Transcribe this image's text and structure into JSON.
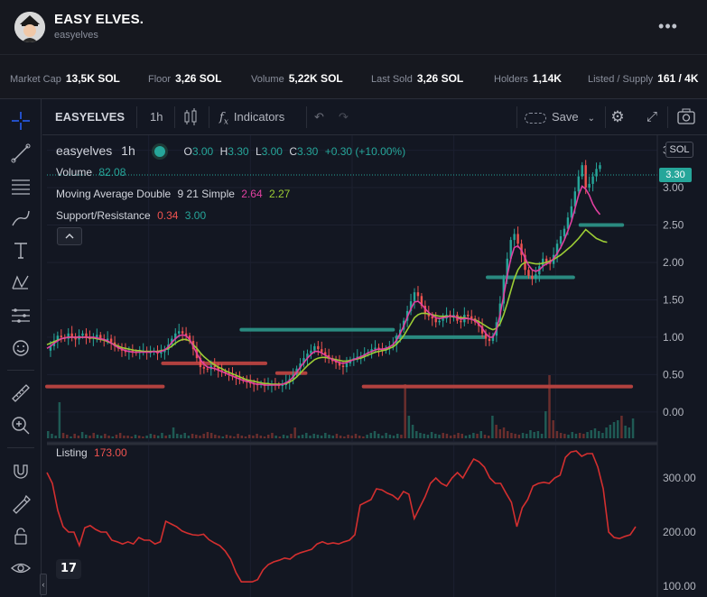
{
  "header": {
    "title": "EASY ELVES.",
    "subtitle": "easyelves",
    "more_label": "•••"
  },
  "stats": [
    {
      "label": "Market Cap",
      "value": "13,5K SOL"
    },
    {
      "label": "Floor",
      "value": "3,26 SOL"
    },
    {
      "label": "Volume",
      "value": "5,22K SOL"
    },
    {
      "label": "Last Sold",
      "value": "3,26 SOL"
    },
    {
      "label": "Holders",
      "value": "1,14K"
    },
    {
      "label": "Listed / Supply",
      "value": "161 / 4K"
    }
  ],
  "toolbar": {
    "symbol": "EASYELVES",
    "interval": "1h",
    "indicators_label": "Indicators",
    "save_label": "Save"
  },
  "legend": {
    "symbol": "easyelves",
    "interval": "1h",
    "o_label": "O",
    "o": "3.00",
    "h_label": "H",
    "h": "3.30",
    "l_label": "L",
    "l": "3.00",
    "c_label": "C",
    "c": "3.30",
    "change": "+0.30 (+10.00%)",
    "volume_label": "Volume",
    "volume": "82.08",
    "ma_label": "Moving Average Double",
    "ma_params": "9 21 Simple",
    "ma1": "2.64",
    "ma2": "2.27",
    "sr_label": "Support/Resistance",
    "sr1": "0.34",
    "sr2": "3.00",
    "listing_label": "Listing",
    "listing": "173.00"
  },
  "price_axis": {
    "currency": "SOL",
    "last_price": "3.30",
    "ticks": [
      "3.50",
      "3.00",
      "2.50",
      "2.00",
      "1.50",
      "1.00",
      "0.50",
      "0.00"
    ]
  },
  "listing_axis": {
    "ticks": [
      "300.00",
      "200.00",
      "100.00"
    ]
  },
  "colors": {
    "up": "#26a69a",
    "down": "#ef5350",
    "ma_fast": "#e040a0",
    "ma_slow": "#9ccc35",
    "support": "#b2413f",
    "resistance": "#2a8a80",
    "listing": "#d32f2f"
  },
  "chart_data": {
    "type": "line",
    "price_series": {
      "name": "easyelves",
      "x": [
        0,
        4,
        8,
        12,
        16,
        20,
        24,
        28,
        32,
        36,
        40,
        44,
        48,
        52,
        56,
        60,
        64,
        68,
        72,
        76,
        80,
        84,
        88,
        92,
        96,
        100,
        104,
        108,
        112,
        116,
        120,
        124,
        128,
        132,
        136,
        140,
        144,
        148,
        152,
        156,
        160,
        164,
        168,
        172,
        176,
        180,
        184,
        188,
        192,
        196,
        200,
        204,
        208,
        212,
        216,
        220,
        224,
        228,
        232,
        236,
        240,
        244,
        248,
        252,
        256,
        260,
        264,
        268,
        272,
        276,
        280,
        284,
        288,
        292,
        296,
        300,
        304,
        308,
        312,
        316,
        320,
        324,
        328,
        332,
        336,
        340,
        344,
        348,
        352,
        356,
        360,
        364,
        368,
        372,
        376,
        380,
        384,
        388,
        392,
        396,
        400,
        404,
        408,
        412,
        416,
        420,
        424,
        428,
        432,
        436,
        440,
        444,
        448,
        452,
        456,
        460,
        464,
        468,
        472,
        476,
        480,
        484,
        488,
        492,
        496,
        500,
        504,
        508,
        512,
        516,
        520,
        524,
        528,
        532,
        536,
        540,
        544,
        548,
        552,
        556,
        560,
        564,
        568,
        572,
        576,
        580,
        584,
        588,
        592,
        596,
        600,
        604,
        608,
        612,
        616,
        620,
        624,
        628,
        632,
        636,
        640,
        644,
        648,
        652,
        656,
        660
      ],
      "y": [
        0.82,
        0.88,
        0.95,
        1.02,
        1.0,
        0.98,
        1.05,
        1.0,
        0.97,
        1.02,
        1.05,
        0.99,
        0.98,
        1.0,
        1.03,
        0.97,
        0.96,
        0.98,
        0.93,
        0.88,
        0.85,
        0.82,
        0.8,
        0.82,
        0.8,
        0.79,
        0.81,
        0.82,
        0.8,
        0.8,
        0.82,
        0.78,
        0.8,
        0.83,
        0.9,
        0.98,
        1.05,
        1.08,
        1.05,
        1.02,
        0.95,
        0.84,
        0.72,
        0.6,
        0.58,
        0.57,
        0.62,
        0.6,
        0.56,
        0.54,
        0.52,
        0.5,
        0.48,
        0.46,
        0.44,
        0.42,
        0.4,
        0.38,
        0.37,
        0.36,
        0.38,
        0.35,
        0.36,
        0.37,
        0.36,
        0.35,
        0.36,
        0.4,
        0.44,
        0.5,
        0.58,
        0.65,
        0.72,
        0.78,
        0.82,
        0.88,
        0.84,
        0.8,
        0.76,
        0.72,
        0.68,
        0.66,
        0.62,
        0.6,
        0.65,
        0.7,
        0.72,
        0.74,
        0.75,
        0.78,
        0.8,
        0.84,
        0.86,
        0.84,
        0.82,
        0.85,
        0.88,
        0.9,
        1.0,
        1.1,
        1.22,
        1.35,
        1.48,
        1.6,
        1.55,
        1.42,
        1.32,
        1.28,
        1.25,
        1.2,
        1.22,
        1.25,
        1.3,
        1.28,
        1.3,
        1.22,
        1.2,
        1.3,
        1.28,
        1.25,
        1.2,
        1.15,
        1.05,
        0.98,
        0.95,
        1.02,
        1.2,
        1.45,
        1.78,
        2.05,
        2.3,
        2.38,
        2.25,
        2.1,
        1.9,
        1.82,
        1.78,
        1.84,
        1.95,
        2.05,
        2.0,
        1.98,
        2.1,
        2.25,
        2.35,
        2.45,
        2.6,
        2.75,
        2.95,
        3.15,
        3.3,
        3.0,
        3.05,
        3.15,
        3.25,
        3.3
      ],
      "ma_fast": [
        0.85,
        0.88,
        0.92,
        0.95,
        0.98,
        0.99,
        1.0,
        1.0,
        1.0,
        1.0,
        1.0,
        1.0,
        1.0,
        1.0,
        0.99,
        0.98,
        0.97,
        0.95,
        0.92,
        0.89,
        0.86,
        0.84,
        0.82,
        0.81,
        0.8,
        0.8,
        0.8,
        0.8,
        0.8,
        0.8,
        0.81,
        0.8,
        0.81,
        0.83,
        0.87,
        0.93,
        0.98,
        1.02,
        1.03,
        1.02,
        0.97,
        0.88,
        0.78,
        0.7,
        0.64,
        0.6,
        0.59,
        0.58,
        0.56,
        0.54,
        0.52,
        0.5,
        0.48,
        0.46,
        0.44,
        0.42,
        0.41,
        0.4,
        0.38,
        0.37,
        0.37,
        0.36,
        0.36,
        0.36,
        0.36,
        0.36,
        0.37,
        0.39,
        0.42,
        0.47,
        0.53,
        0.6,
        0.66,
        0.72,
        0.77,
        0.81,
        0.81,
        0.79,
        0.76,
        0.73,
        0.7,
        0.68,
        0.66,
        0.65,
        0.66,
        0.68,
        0.7,
        0.72,
        0.74,
        0.76,
        0.79,
        0.81,
        0.83,
        0.84,
        0.84,
        0.85,
        0.87,
        0.9,
        0.96,
        1.05,
        1.15,
        1.27,
        1.38,
        1.47,
        1.48,
        1.44,
        1.38,
        1.33,
        1.29,
        1.26,
        1.25,
        1.26,
        1.27,
        1.28,
        1.28,
        1.26,
        1.24,
        1.25,
        1.25,
        1.24,
        1.22,
        1.18,
        1.12,
        1.05,
        1.0,
        1.0,
        1.1,
        1.3,
        1.55,
        1.82,
        2.05,
        2.2,
        2.22,
        2.16,
        2.06,
        1.96,
        1.9,
        1.88,
        1.9,
        1.95,
        1.98,
        2.0,
        2.05,
        2.12,
        2.2,
        2.3,
        2.42,
        2.55,
        2.72,
        2.9,
        3.02,
        2.98,
        2.9,
        2.78,
        2.7,
        2.64
      ],
      "ma_slow": [
        0.9,
        0.92,
        0.94,
        0.96,
        0.98,
        0.99,
        1.0,
        1.0,
        1.0,
        1.0,
        1.0,
        1.0,
        0.99,
        0.99,
        0.98,
        0.97,
        0.96,
        0.94,
        0.92,
        0.9,
        0.88,
        0.86,
        0.85,
        0.84,
        0.83,
        0.82,
        0.82,
        0.81,
        0.81,
        0.81,
        0.81,
        0.81,
        0.82,
        0.83,
        0.85,
        0.88,
        0.92,
        0.95,
        0.97,
        0.97,
        0.95,
        0.9,
        0.85,
        0.79,
        0.74,
        0.7,
        0.66,
        0.63,
        0.6,
        0.58,
        0.55,
        0.53,
        0.51,
        0.49,
        0.47,
        0.45,
        0.43,
        0.42,
        0.41,
        0.4,
        0.39,
        0.38,
        0.38,
        0.37,
        0.37,
        0.37,
        0.37,
        0.38,
        0.4,
        0.43,
        0.47,
        0.52,
        0.57,
        0.62,
        0.66,
        0.7,
        0.72,
        0.73,
        0.73,
        0.72,
        0.71,
        0.7,
        0.69,
        0.68,
        0.68,
        0.69,
        0.7,
        0.71,
        0.72,
        0.74,
        0.76,
        0.78,
        0.8,
        0.81,
        0.82,
        0.83,
        0.85,
        0.87,
        0.91,
        0.96,
        1.02,
        1.1,
        1.18,
        1.26,
        1.3,
        1.32,
        1.32,
        1.31,
        1.3,
        1.29,
        1.28,
        1.28,
        1.28,
        1.28,
        1.27,
        1.27,
        1.26,
        1.26,
        1.25,
        1.24,
        1.23,
        1.21,
        1.18,
        1.15,
        1.12,
        1.1,
        1.12,
        1.18,
        1.3,
        1.45,
        1.62,
        1.78,
        1.9,
        1.97,
        2.0,
        2.0,
        1.99,
        1.98,
        1.98,
        1.99,
        2.0,
        2.02,
        2.04,
        2.07,
        2.1,
        2.14,
        2.18,
        2.22,
        2.27,
        2.32,
        2.38,
        2.44,
        2.4,
        2.36,
        2.32,
        2.3,
        2.28,
        2.27
      ]
    },
    "support_resistance": [
      {
        "y": 0.34,
        "x0": 0,
        "x1": 130
      },
      {
        "y": 0.34,
        "x0": 355,
        "x1": 655
      },
      {
        "y": 0.65,
        "x0": 130,
        "x1": 245
      },
      {
        "y": 0.52,
        "x0": 258,
        "x1": 290
      },
      {
        "y": 1.1,
        "x0": 218,
        "x1": 388
      },
      {
        "y": 1.0,
        "x0": 392,
        "x1": 490
      },
      {
        "y": 1.8,
        "x0": 494,
        "x1": 590
      },
      {
        "y": 2.5,
        "x0": 598,
        "x1": 645
      }
    ],
    "volume": [
      8,
      5,
      3,
      40,
      6,
      4,
      2,
      5,
      3,
      7,
      4,
      3,
      6,
      4,
      3,
      5,
      3,
      2,
      4,
      6,
      3,
      3,
      2,
      4,
      3,
      2,
      3,
      5,
      4,
      3,
      6,
      3,
      4,
      12,
      5,
      4,
      6,
      3,
      5,
      4,
      3,
      5,
      7,
      6,
      4,
      3,
      2,
      4,
      3,
      2,
      5,
      3,
      2,
      4,
      3,
      5,
      3,
      2,
      4,
      6,
      3,
      2,
      4,
      3,
      5,
      12,
      3,
      4,
      6,
      3,
      5,
      4,
      3,
      6,
      4,
      3,
      5,
      3,
      2,
      4,
      3,
      5,
      3,
      2,
      4,
      6,
      8,
      5,
      3,
      6,
      4,
      3,
      5,
      4,
      60,
      25,
      15,
      8,
      6,
      5,
      4,
      7,
      5,
      4,
      6,
      5,
      3,
      4,
      6,
      5,
      3,
      4,
      6,
      5,
      8,
      4,
      3,
      25,
      15,
      10,
      12,
      8,
      6,
      5,
      4,
      6,
      5,
      9,
      7,
      8,
      5,
      30,
      70,
      20,
      8,
      6,
      5,
      4,
      7,
      5,
      6,
      5,
      7,
      9,
      11,
      8,
      6,
      12,
      15,
      18,
      20,
      25,
      14,
      12,
      22
    ],
    "listing": {
      "name": "Listing",
      "x": [
        0,
        6,
        12,
        18,
        24,
        30,
        36,
        42,
        48,
        54,
        60,
        66,
        72,
        78,
        84,
        90,
        96,
        102,
        108,
        114,
        120,
        126,
        132,
        138,
        144,
        150,
        156,
        162,
        168,
        174,
        180,
        186,
        192,
        198,
        204,
        210,
        216,
        222,
        228,
        234,
        240,
        246,
        252,
        258,
        264,
        270,
        276,
        282,
        288,
        294,
        300,
        306,
        312,
        318,
        324,
        330,
        336,
        342,
        348,
        354,
        360,
        366,
        372,
        378,
        384,
        390,
        396,
        402,
        408,
        414,
        420,
        426,
        432,
        438,
        444,
        450,
        456,
        462,
        468,
        474,
        480,
        486,
        492,
        498,
        504,
        510,
        516,
        522,
        528,
        534,
        540,
        546,
        552,
        558,
        564,
        570,
        576,
        582,
        588,
        594,
        600,
        606,
        612,
        618,
        624,
        630,
        636,
        642,
        648,
        654
      ],
      "y": [
        310,
        290,
        240,
        210,
        200,
        200,
        175,
        208,
        212,
        205,
        200,
        200,
        185,
        182,
        178,
        182,
        178,
        190,
        185,
        185,
        178,
        182,
        220,
        215,
        210,
        202,
        198,
        195,
        194,
        196,
        186,
        180,
        175,
        165,
        150,
        125,
        108,
        108,
        108,
        112,
        130,
        140,
        145,
        148,
        152,
        150,
        158,
        162,
        165,
        168,
        178,
        182,
        178,
        180,
        178,
        182,
        185,
        195,
        250,
        255,
        260,
        280,
        278,
        272,
        268,
        260,
        275,
        270,
        225,
        245,
        265,
        290,
        300,
        290,
        285,
        300,
        310,
        300,
        318,
        335,
        330,
        320,
        300,
        290,
        290,
        272,
        255,
        210,
        245,
        260,
        285,
        290,
        292,
        290,
        300,
        305,
        338,
        348,
        350,
        340,
        345,
        345,
        320,
        280,
        200,
        190,
        188,
        192,
        195,
        210,
        205,
        200,
        190,
        175,
        173
      ],
      "ylim": [
        80,
        360
      ]
    },
    "price_ylim": [
      -0.4,
      3.7
    ]
  }
}
